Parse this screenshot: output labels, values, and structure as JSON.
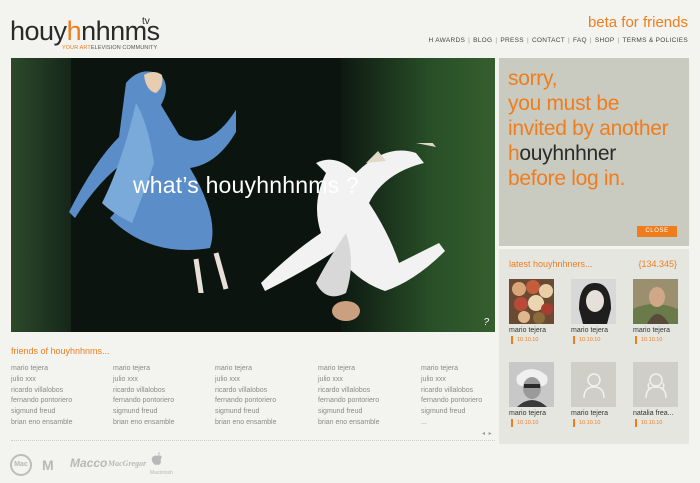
{
  "header": {
    "logo_pre": "houy",
    "logo_h": "h",
    "logo_post": "nhnms",
    "logo_tv": "tv",
    "tagline_a": "YOUR ART",
    "tagline_b": "ELEVISION COMMUNITY",
    "beta": "beta for friends",
    "nav": [
      "H AWARDS",
      "BLOG",
      "PRESS",
      "CONTACT",
      "FAQ",
      "SHOP",
      "TERMS & POLICIES"
    ]
  },
  "hero": {
    "text": "what’s houyhnhnms ?",
    "help": "?"
  },
  "sorry": {
    "line1": "sorry,",
    "line2": "you must be",
    "line3": "invited by another",
    "line4_h": "h",
    "line4_rest": "ouyhnhner",
    "line5": "before log in.",
    "close_label": "CLOSE"
  },
  "latest": {
    "title": "latest houyhnhners...",
    "count": "{134.345}",
    "members": [
      {
        "name": "mario tejera",
        "date": "10.10.10",
        "kind": "flowers"
      },
      {
        "name": "mario tejera",
        "date": "10.10.10",
        "kind": "woman-dark"
      },
      {
        "name": "mario tejera",
        "date": "10.10.10",
        "kind": "man-field"
      },
      {
        "name": "mario tejera",
        "date": "10.10.10",
        "kind": "woman-bw"
      },
      {
        "name": "mario tejera",
        "date": "10.10.10",
        "kind": "placeholder"
      },
      {
        "name": "natalia frea...",
        "date": "10.10.10",
        "kind": "placeholder"
      }
    ]
  },
  "friends": {
    "title": "friends of houyhnhnms...",
    "columns": [
      [
        "mario tejera",
        "julio xxx",
        "ricardo villalobos",
        "fernando pontoriero",
        "sigmund freud",
        "brian eno ensamble"
      ],
      [
        "mario tejera",
        "julio xxx",
        "ricardo villalobos",
        "fernando pontoriero",
        "sigmund freud",
        "brian eno ensamble"
      ],
      [
        "mario tejera",
        "julio xxx",
        "ricardo villalobos",
        "fernando pontoriero",
        "sigmund freud",
        "brian eno ensamble"
      ],
      [
        "mario tejera",
        "julio xxx",
        "ricardo villalobos",
        "fernando pontoriero",
        "sigmund freud",
        "brian eno ensamble"
      ],
      [
        "mario tejera",
        "julio xxx",
        "ricardo villalobos",
        "fernando pontoriero",
        "sigmund freud",
        "..."
      ]
    ],
    "pager": "◂ ▸"
  },
  "sponsors": [
    "Mac",
    "M",
    "Macco",
    "MacGregor",
    "Macintosh"
  ],
  "colors": {
    "accent": "#ef7d1e",
    "panel": "#c9cbc0",
    "background": "#f3f3ef"
  }
}
